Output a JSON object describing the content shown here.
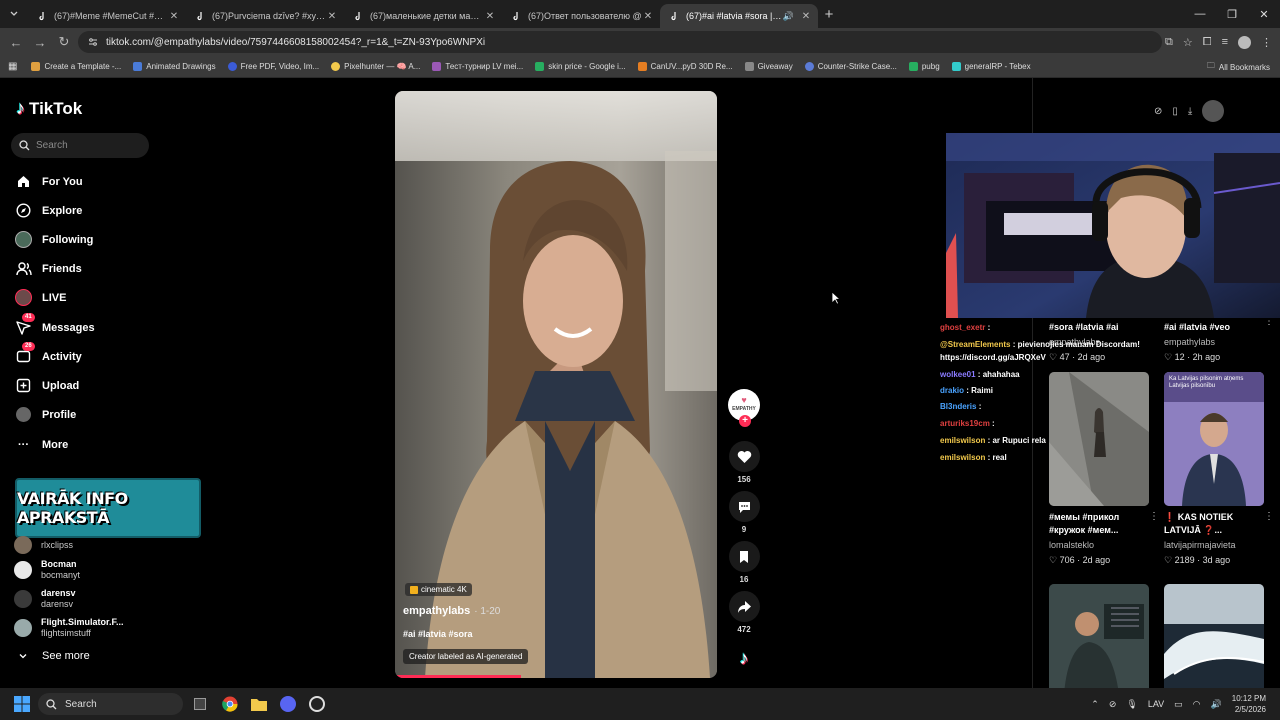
{
  "browser": {
    "tabs": [
      {
        "title": "(67)#Meme #MemeCut #CapC",
        "active": false
      },
      {
        "title": "(67)Purvciema dzīve? #xyzabc#",
        "active": false
      },
      {
        "title": "(67)маленькие детки маленьк",
        "active": false
      },
      {
        "title": "(67)Ответ пользователю @",
        "active": false
      },
      {
        "title": "(67)#ai #latvia #sora | TikTo",
        "active": true
      }
    ],
    "url": "tiktok.com/@empathylabs/video/7597446608158002454?_r=1&_t=ZN-93Ypo6WNPXi",
    "bookmarks": [
      {
        "label": "Create a Template -...",
        "color": "#e0a040"
      },
      {
        "label": "Animated Drawings",
        "color": "#4a7bd8"
      },
      {
        "label": "Free PDF, Video, Im...",
        "color": "#3b5bd6"
      },
      {
        "label": "Pixelhunter — 🧠 A...",
        "color": "#f2c94c"
      },
      {
        "label": "Тест-турнир LV mei...",
        "color": "#9b59b6"
      },
      {
        "label": "skin price - Google i...",
        "color": "#27ae60"
      },
      {
        "label": "CanUV...pyD 30D Re...",
        "color": "#e67e22"
      },
      {
        "label": "Giveaway",
        "color": "#888888"
      },
      {
        "label": "Counter-Strike Case...",
        "color": "#5b7bd6"
      },
      {
        "label": "pubg",
        "color": "#27ae60"
      },
      {
        "label": "generalRP - Tebex",
        "color": "#3cc"
      }
    ],
    "all_bookmarks": "All Bookmarks"
  },
  "tiktok": {
    "logo": "TikTok",
    "search_placeholder": "Search",
    "nav": {
      "for_you": "For You",
      "explore": "Explore",
      "following": "Following",
      "friends": "Friends",
      "live": "LIVE",
      "messages": "Messages",
      "messages_badge": "41",
      "activity": "Activity",
      "activity_badge": "26",
      "upload": "Upload",
      "profile": "Profile",
      "more": "More"
    },
    "promo_banner": "VAIRĀK INFO APRAKSTĀ",
    "following_accounts": [
      {
        "name": "",
        "handle": "rlxclipss"
      },
      {
        "name": "Bocman",
        "handle": "bocmanyt"
      },
      {
        "name": "darensv",
        "handle": "darensv"
      },
      {
        "name": "Flight.Simulator.F...",
        "handle": "flightsimstuff"
      }
    ],
    "see_more": "See more",
    "video": {
      "chip": "cinematic 4K",
      "author": "empathylabs",
      "date": "· 1-20",
      "tags": "#ai #latvia #sora",
      "ai_label": "Creator labeled as AI-generated",
      "progress": 0.39
    },
    "actions": {
      "avatar_text": "EMPATHY",
      "likes": "156",
      "comments": "9",
      "saves": "16",
      "shares": "472"
    }
  },
  "overlay_chat": [
    {
      "user": "ghost_exetr",
      "user_color": "#e04040",
      "message": ""
    },
    {
      "user": "@StreamElements",
      "user_color": "#f2c94c",
      "message": "pievienojies manam Discordam!"
    },
    {
      "user": "",
      "user_color": "#ffffff",
      "message": "https://discord.gg/aJRQXeV"
    },
    {
      "user": "wolkee01",
      "user_color": "#8a7bff",
      "message": "ahahahaa"
    },
    {
      "user": "drakio",
      "user_color": "#4aa3ff",
      "message": "Raimi"
    },
    {
      "user": "Bl3nderis",
      "user_color": "#4aa3ff",
      "message": ""
    },
    {
      "user": "arturiks19cm",
      "user_color": "#e04040",
      "message": ""
    },
    {
      "user": "emilswilson",
      "user_color": "#f2c94c",
      "message": "ar Rupuci rela"
    },
    {
      "user": "emilswilson",
      "user_color": "#f2c94c",
      "message": "real"
    }
  ],
  "grid": [
    {
      "caption": "#sora #latvia #ai",
      "author": "empathylabs",
      "likes": "47",
      "age": "2d ago"
    },
    {
      "caption": "#ai #latvia #veo",
      "author": "empathylabs",
      "likes": "12",
      "age": "2h ago"
    },
    {
      "caption": "#мемы #прикол #кружок #мем...",
      "author": "lomalsteklo",
      "likes": "706",
      "age": "2d ago"
    },
    {
      "caption": "KAS NOTIEK LATVIJĀ ❓...",
      "author": "latvijapirmajavieta",
      "likes": "2189",
      "age": "3d ago",
      "thumb_text": "Ka Latvijas pilsonim atņems Latvijas pilsonību"
    }
  ],
  "taskbar": {
    "search_placeholder": "Search",
    "lang": "LAV",
    "time": "10:12 PM",
    "date": "2/5/2026"
  }
}
